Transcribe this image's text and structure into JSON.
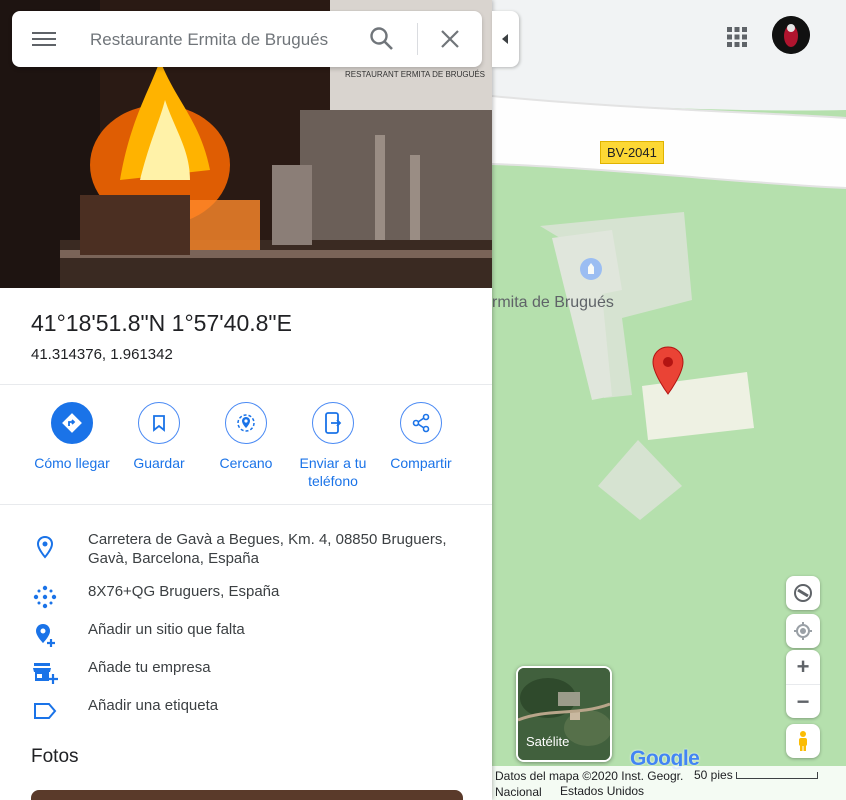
{
  "search": {
    "placeholder": "Restaurante Ermita de Brugués"
  },
  "hero": {
    "watermark": "RESTAURANT ERMITA DE BRUGUÉS"
  },
  "place": {
    "coords_dms": "41°18'51.8\"N 1°57'40.8\"E",
    "coords_decimal": "41.314376, 1.961342"
  },
  "actions": [
    {
      "label": "Cómo llegar",
      "icon": "directions-icon"
    },
    {
      "label": "Guardar",
      "icon": "bookmark-icon"
    },
    {
      "label": "Cercano",
      "icon": "nearby-icon"
    },
    {
      "label": "Enviar a tu teléfono",
      "icon": "send-to-phone-icon"
    },
    {
      "label": "Compartir",
      "icon": "share-icon"
    }
  ],
  "info": [
    {
      "text": "Carretera de Gavà a Begues, Km. 4, 08850 Bruguers, Gavà, Barcelona, España",
      "icon": "location-pin-icon"
    },
    {
      "text": "8X76+QG Bruguers, España",
      "icon": "plus-code-icon"
    },
    {
      "text": "Añadir un sitio que falta",
      "icon": "add-place-icon"
    },
    {
      "text": "Añade tu empresa",
      "icon": "add-business-icon"
    },
    {
      "text": "Añadir una etiqueta",
      "icon": "label-icon"
    }
  ],
  "photos": {
    "heading": "Fotos"
  },
  "map": {
    "road_label": "BV-2041",
    "place_label": "rmita de Brugués",
    "satellite_label": "Satélite",
    "attribution": "Datos del mapa ©2020 Inst. Geogr. Nacional",
    "country": "Estados Unidos",
    "scale": "50 pies",
    "google_logo": "Google",
    "zoom_in": "+",
    "zoom_out": "−"
  },
  "colors": {
    "accent": "#1a73e8",
    "marker": "#ea4335",
    "map_green": "#b5e0ad",
    "road_badge": "#fdd835"
  }
}
